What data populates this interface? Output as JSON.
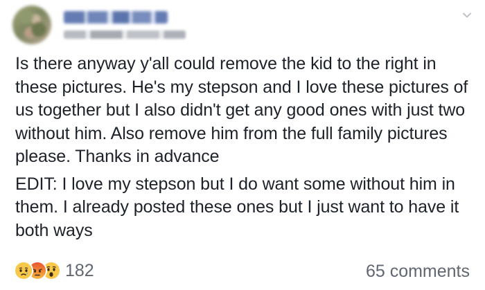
{
  "post": {
    "paragraphs": [
      "Is there anyway y'all could remove the kid to the right in these pictures. He's my stepson and I love these pictures of us together but I also didn't get any good ones with just two without him. Also remove him from the full family pictures please. Thanks in advance",
      "EDIT: I love my stepson but I do want some without him in them. I already posted these ones but I just want to have it both ways"
    ]
  },
  "footer": {
    "reactions": [
      "sad-icon",
      "angry-icon",
      "wow-icon"
    ],
    "reaction_count": "182",
    "comments": "65 comments"
  },
  "colors": {
    "text": "#1d2129",
    "secondary_text": "#606770",
    "reaction_yellow": "#f7c84a",
    "reaction_red": "#e9542e"
  }
}
